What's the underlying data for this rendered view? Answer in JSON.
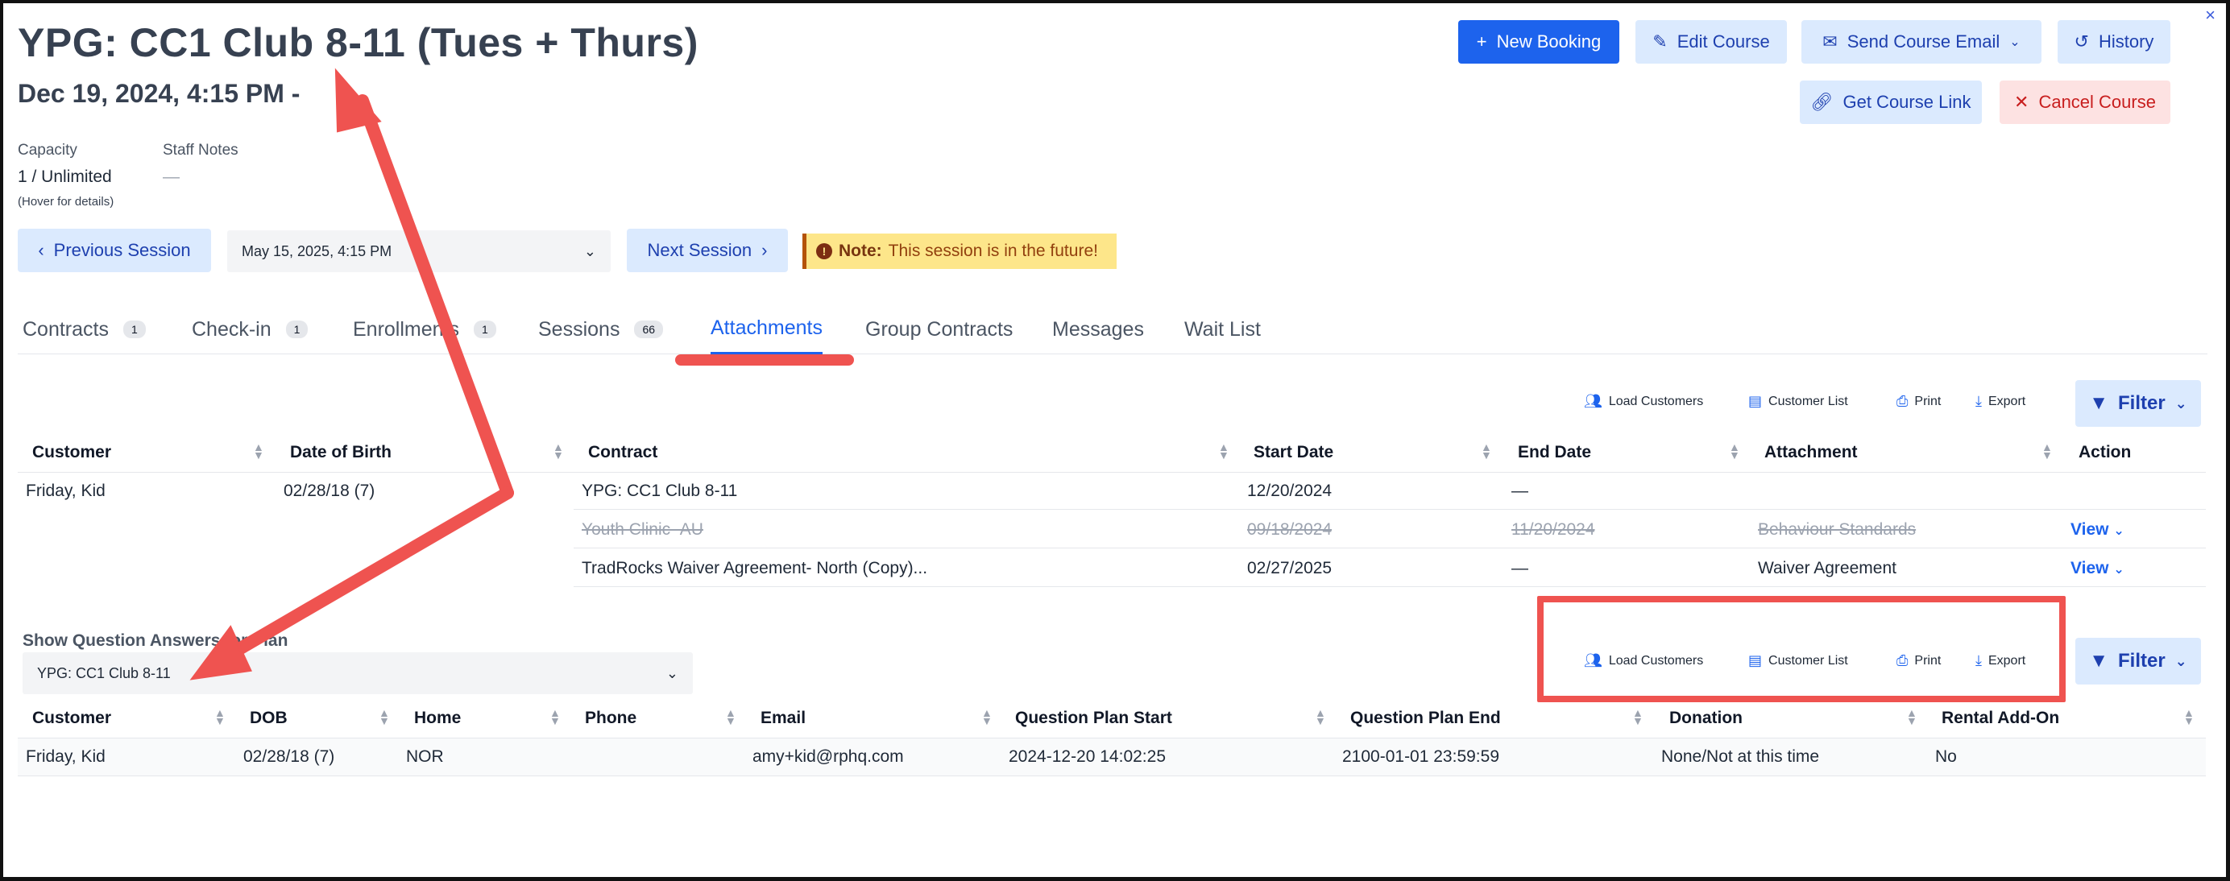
{
  "header": {
    "title": "YPG: CC1 Club 8-11 (Tues + Thurs)",
    "subtitle": "Dec 19, 2024, 4:15 PM -",
    "close": "×"
  },
  "meta": {
    "capacity_label": "Capacity",
    "capacity_value": "1 / Unlimited",
    "capacity_hint": "(Hover for details)",
    "staff_notes_label": "Staff Notes",
    "staff_notes_value": "—"
  },
  "actions": {
    "new_booking": "New Booking",
    "edit_course": "Edit Course",
    "send_course_email": "Send Course Email",
    "history": "History",
    "get_course_link": "Get Course Link",
    "cancel_course": "Cancel Course"
  },
  "session_nav": {
    "previous": "Previous Session",
    "selected": "May 15, 2025, 4:15 PM",
    "next": "Next Session",
    "note_bold": "Note:",
    "note_text": "This session is in the future!"
  },
  "tabs": [
    {
      "label": "Contracts",
      "badge": "1"
    },
    {
      "label": "Check-in",
      "badge": "1"
    },
    {
      "label": "Enrollments",
      "badge": "1"
    },
    {
      "label": "Sessions",
      "badge": "66"
    },
    {
      "label": "Attachments",
      "badge": ""
    },
    {
      "label": "Group Contracts",
      "badge": ""
    },
    {
      "label": "Messages",
      "badge": ""
    },
    {
      "label": "Wait List",
      "badge": ""
    }
  ],
  "toolbar": {
    "load_customers": "Load Customers",
    "customer_list": "Customer List",
    "print": "Print",
    "export": "Export",
    "filter": "Filter"
  },
  "attachments_table": {
    "headers": [
      "Customer",
      "Date of Birth",
      "Contract",
      "Start Date",
      "End Date",
      "Attachment",
      "Action"
    ],
    "customer": "Friday, Kid",
    "dob": "02/28/18 (7)",
    "rows": [
      {
        "contract": "YPG: CC1 Club 8-11",
        "start": "12/20/2024",
        "end": "—",
        "attachment": "",
        "action": ""
      },
      {
        "contract": "Youth Clinic- AU",
        "start": "09/18/2024",
        "end": "11/20/2024",
        "attachment": "Behaviour Standards",
        "action": "View"
      },
      {
        "contract": "TradRocks Waiver Agreement- North (Copy)...",
        "start": "02/27/2025",
        "end": "—",
        "attachment": "Waiver Agreement",
        "action": "View"
      }
    ]
  },
  "question_plan": {
    "label": "Show Question Answers for Plan",
    "selected": "YPG: CC1 Club 8-11"
  },
  "answers_table": {
    "headers": [
      "Customer",
      "DOB",
      "Home",
      "Phone",
      "Email",
      "Question Plan Start",
      "Question Plan End",
      "Donation",
      "Rental Add-On"
    ],
    "rows": [
      {
        "customer": "Friday, Kid",
        "dob": "02/28/18 (7)",
        "home": "NOR",
        "phone": "",
        "email": "amy+kid@rphq.com",
        "qp_start": "2024-12-20 14:02:25",
        "qp_end": "2100-01-01 23:59:59",
        "donation": "None/Not at this time",
        "rental": "No"
      }
    ]
  },
  "colors": {
    "primary": "#1d63ed",
    "light": "#dbeafe",
    "danger": "#c81e1e",
    "annotation": "#ef5350",
    "note_bg": "#fde68a"
  }
}
